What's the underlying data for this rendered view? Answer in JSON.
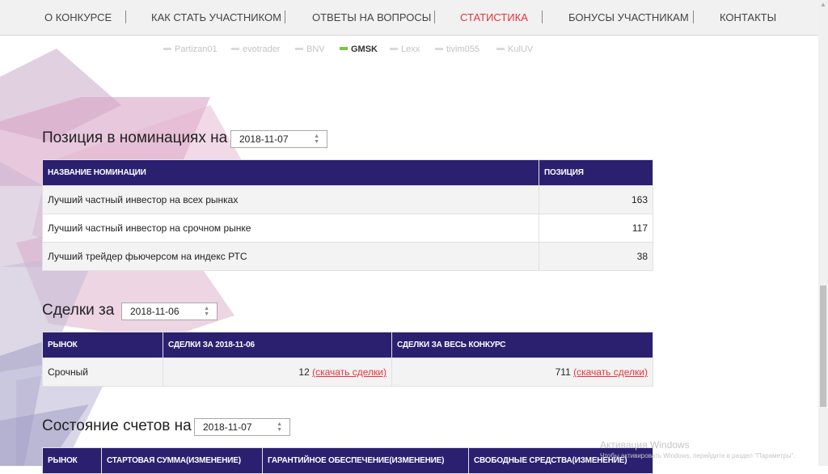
{
  "nav": {
    "items": [
      {
        "label": "О КОНКУРСЕ"
      },
      {
        "label": "КАК СТАТЬ УЧАСТНИКОМ"
      },
      {
        "label": "ОТВЕТЫ НА ВОПРОСЫ"
      },
      {
        "label": "СТАТИСТИКА",
        "active": true
      },
      {
        "label": "БОНУСЫ УЧАСТНИКАМ"
      },
      {
        "label": "КОНТАКТЫ"
      }
    ],
    "active_color": "#e8323c"
  },
  "legend": {
    "items": [
      {
        "name": "Partizan01",
        "active": false
      },
      {
        "name": "evotrader",
        "active": false
      },
      {
        "name": "BNV",
        "active": false
      },
      {
        "name": "GMSK",
        "active": true
      },
      {
        "name": "Lexx",
        "active": false
      },
      {
        "name": "tivim055",
        "active": false
      },
      {
        "name": "KulUV",
        "active": false
      }
    ],
    "active_color": "#7dc24e"
  },
  "nominations": {
    "title": "Позиция в номинациях на",
    "date": "2018-11-07",
    "headers": {
      "name": "НАЗВАНИЕ НОМИНАЦИИ",
      "position": "ПОЗИЦИЯ"
    },
    "rows": [
      {
        "name": "Лучший частный инвестор на всех рынках",
        "position": "163"
      },
      {
        "name": "Лучший частный инвестор на срочном рынке",
        "position": "117"
      },
      {
        "name": "Лучший трейдер фьючерсом на индекс РТС",
        "position": "38"
      }
    ]
  },
  "deals": {
    "title": "Сделки за",
    "date": "2018-11-06",
    "headers": {
      "market": "РЫНОК",
      "day": "СДЕЛКИ ЗА 2018-11-06",
      "total": "СДЕЛКИ ЗА ВЕСЬ КОНКУРС"
    },
    "rows": [
      {
        "market": "Срочный",
        "day_count": "12",
        "day_link": "(скачать сделки)",
        "total_count": "711",
        "total_link": "(скачать сделки)"
      }
    ]
  },
  "accounts": {
    "title": "Состояние счетов на",
    "date": "2018-11-07",
    "headers": {
      "market": "РЫНОК",
      "start": "СТАРТОВАЯ СУММА(ИЗМЕНЕНИЕ)",
      "margin": "ГАРАНТИЙНОЕ ОБЕСПЕЧЕНИЕ(ИЗМЕНЕНИЕ)",
      "free": "СВОБОДНЫЕ СРЕДСТВА(ИЗМЕНЕНИЕ)"
    }
  },
  "watermark": {
    "title": "Активация Windows",
    "subtitle": "Чтобы активировать Windows, перейдите в раздел \"Параметры\"."
  },
  "colors": {
    "header_bg": "#2b2070",
    "link": "#e8323c"
  }
}
